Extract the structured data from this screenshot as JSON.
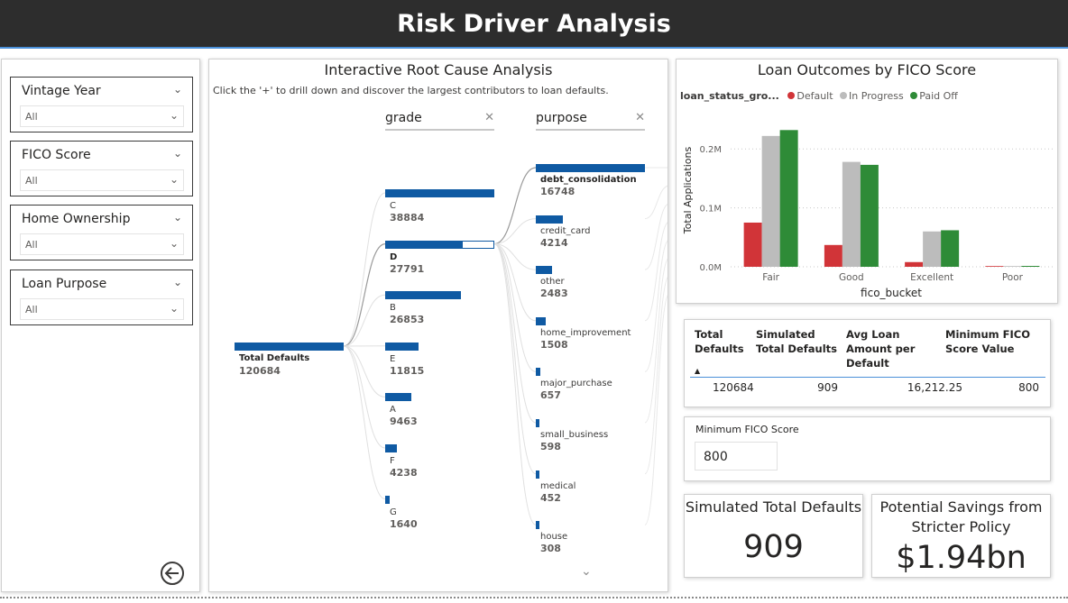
{
  "header": {
    "title": "Risk Driver Analysis"
  },
  "slicers": [
    {
      "title": "Vintage Year",
      "value": "All"
    },
    {
      "title": "FICO Score",
      "value": "All"
    },
    {
      "title": "Home Ownership",
      "value": "All"
    },
    {
      "title": "Loan Purpose",
      "value": "All"
    }
  ],
  "tree": {
    "title": "Interactive Root Cause Analysis",
    "subtitle": "Click the '+' to drill down and discover the largest contributors to loan defaults.",
    "col1": "grade",
    "col2": "purpose",
    "root": {
      "label": "Total Defaults",
      "value": "120684",
      "amount": 120684
    },
    "grade": [
      {
        "label": "C",
        "value": "38884",
        "amount": 38884
      },
      {
        "label": "D",
        "value": "27791",
        "amount": 27791,
        "selected": true
      },
      {
        "label": "B",
        "value": "26853",
        "amount": 26853
      },
      {
        "label": "E",
        "value": "11815",
        "amount": 11815
      },
      {
        "label": "A",
        "value": "9463",
        "amount": 9463
      },
      {
        "label": "F",
        "value": "4238",
        "amount": 4238
      },
      {
        "label": "G",
        "value": "1640",
        "amount": 1640
      }
    ],
    "purpose": [
      {
        "label": "debt_consolidation",
        "value": "16748",
        "amount": 16748,
        "bold": true
      },
      {
        "label": "credit_card",
        "value": "4214",
        "amount": 4214
      },
      {
        "label": "other",
        "value": "2483",
        "amount": 2483
      },
      {
        "label": "home_improvement",
        "value": "1508",
        "amount": 1508
      },
      {
        "label": "major_purchase",
        "value": "657",
        "amount": 657
      },
      {
        "label": "small_business",
        "value": "598",
        "amount": 598
      },
      {
        "label": "medical",
        "value": "452",
        "amount": 452
      },
      {
        "label": "house",
        "value": "308",
        "amount": 308
      }
    ]
  },
  "chart_data": {
    "type": "bar",
    "title": "Loan Outcomes by FICO Score",
    "legend_title": "loan_status_gro...",
    "xlabel": "fico_bucket",
    "ylabel": "Total Applications",
    "categories": [
      "Fair",
      "Good",
      "Excellent",
      "Poor"
    ],
    "yticks": [
      "0.0M",
      "0.1M",
      "0.2M"
    ],
    "ylim": [
      0,
      260000
    ],
    "series": [
      {
        "name": "Default",
        "color": "#d13438",
        "values": [
          75000,
          37000,
          8000,
          500
        ]
      },
      {
        "name": "In Progress",
        "color": "#bcbcbc",
        "values": [
          222000,
          178000,
          60000,
          1000
        ]
      },
      {
        "name": "Paid Off",
        "color": "#2e8b37",
        "values": [
          232000,
          173000,
          62000,
          1500
        ]
      }
    ],
    "grid": true,
    "legend_position": "top-left"
  },
  "table": {
    "headers": [
      "Total Defaults",
      "Simulated Total Defaults",
      "Avg Loan Amount per Default",
      "Minimum FICO Score Value"
    ],
    "row": [
      "120684",
      "909",
      "16,212.25",
      "800"
    ]
  },
  "min_fico": {
    "label": "Minimum FICO Score",
    "value": "800"
  },
  "cards": {
    "simulated": {
      "title": "Simulated Total Defaults",
      "value": "909"
    },
    "savings": {
      "title": "Potential Savings from Stricter Policy",
      "value": "$1.94bn"
    }
  },
  "icons": {
    "back": "back-arrow-icon",
    "dropdown": "chevron-down-icon",
    "clear": "close-icon",
    "scroll": "chevron-down-icon"
  }
}
